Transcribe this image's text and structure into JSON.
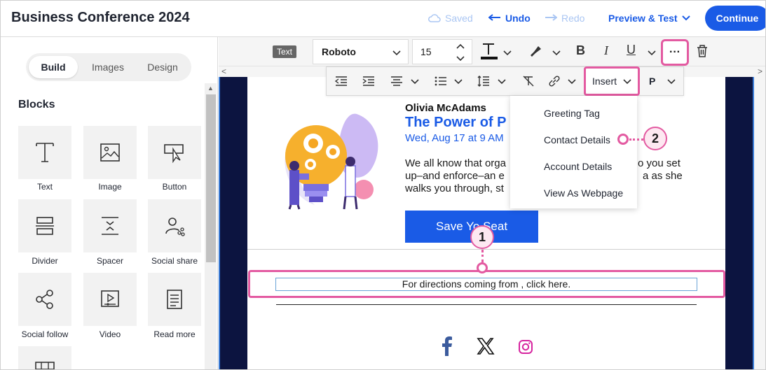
{
  "header": {
    "title": "Business Conference 2024",
    "saved": "Saved",
    "undo": "Undo",
    "redo": "Redo",
    "preview": "Preview & Test",
    "continue": "Continue"
  },
  "sidebar": {
    "tabs": [
      {
        "label": "Build",
        "active": true
      },
      {
        "label": "Images",
        "active": false
      },
      {
        "label": "Design",
        "active": false
      }
    ],
    "blocks_title": "Blocks",
    "blocks": [
      {
        "label": "Text",
        "icon": "text-icon"
      },
      {
        "label": "Image",
        "icon": "image-icon"
      },
      {
        "label": "Button",
        "icon": "button-icon"
      },
      {
        "label": "Divider",
        "icon": "divider-icon"
      },
      {
        "label": "Spacer",
        "icon": "spacer-icon"
      },
      {
        "label": "Social share",
        "icon": "social-share-icon"
      },
      {
        "label": "Social follow",
        "icon": "social-follow-icon"
      },
      {
        "label": "Video",
        "icon": "video-icon"
      },
      {
        "label": "Read more",
        "icon": "read-more-icon"
      }
    ]
  },
  "toolbar": {
    "badge": "Text",
    "font": "Roboto",
    "size": "15",
    "more": "···"
  },
  "toolbar2": {
    "insert": "Insert",
    "paragraph": "P"
  },
  "insert_menu": {
    "items": [
      "Greeting Tag",
      "Contact Details",
      "Account Details",
      "View As Webpage"
    ]
  },
  "email": {
    "speaker": "Olivia McAdams",
    "title": "The Power of P",
    "date": "Wed, Aug 17 at 9 AM",
    "body_left": [
      "We all know that orga",
      "up–and enforce–an e",
      "walks you through, st"
    ],
    "body_right": [
      "o you set",
      "a as she"
    ],
    "cta": "Save Yo   Seat",
    "directions": "For directions coming from , click here."
  },
  "callouts": [
    "1",
    "2"
  ],
  "colors": {
    "accent": "#1a5be6",
    "highlight": "#e35aa1",
    "navy": "#0c1440"
  }
}
